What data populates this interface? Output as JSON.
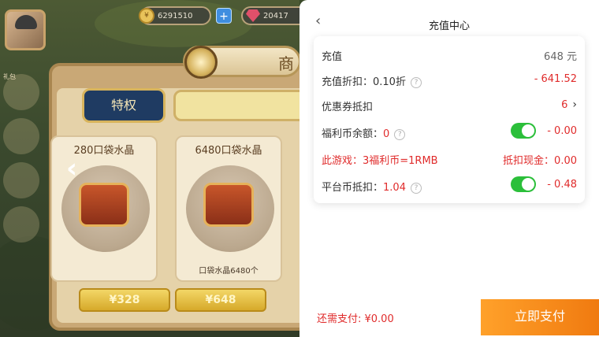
{
  "game": {
    "gold_amount": "6291510",
    "gem_amount": "20417",
    "plus_label": "+",
    "shop_title": "商",
    "tab_tequan": "特权",
    "side_label": "礼包",
    "cards": [
      {
        "title": "280口袋水晶",
        "price": "¥328"
      },
      {
        "title": "6480口袋水晶",
        "subtitle": "口袋水晶6480个",
        "price": "¥648"
      }
    ]
  },
  "panel": {
    "back_icon": "chevron-left-icon",
    "title": "充值中心",
    "rows": {
      "recharge": {
        "label": "充值",
        "value": "648 元"
      },
      "discount": {
        "label": "充值折扣：0.10折",
        "value": "- 641.52"
      },
      "coupon": {
        "label": "优惠券抵扣",
        "value": "6"
      },
      "welfare": {
        "label": "福利币余额：",
        "amount": "0",
        "value": "- 0.00"
      },
      "game_rate": {
        "label": "此游戏：3福利币=1RMB",
        "value": "抵扣现金：0.00"
      },
      "platform": {
        "label": "平台币抵扣：",
        "amount": "1.04",
        "value": "- 0.48"
      }
    },
    "help_glyph": "?",
    "chevron_glyph": "›",
    "footer": {
      "need_pay": "还需支付: ¥0.00",
      "pay_button": "立即支付"
    },
    "colors": {
      "accent": "#f07a10",
      "red": "#e02b2b",
      "toggle": "#2bbf3a"
    }
  }
}
